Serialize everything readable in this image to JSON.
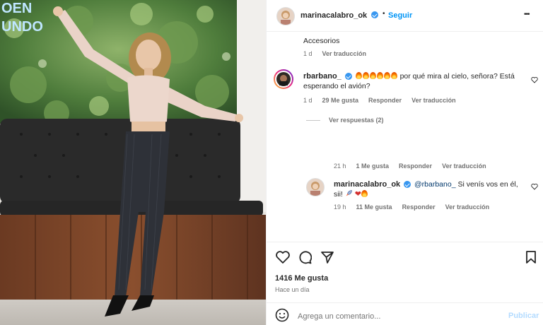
{
  "post": {
    "author": "marinacalabro_ok",
    "follow": "Seguir",
    "more": "•••",
    "photo_text": "OEN UNDO"
  },
  "caption_tail": {
    "text": "Accesorios",
    "time": "1 d",
    "translate": "Ver traducción"
  },
  "comment1": {
    "user": "rbarbano_",
    "text_line1": "por qué mira al cielo, señora? Está",
    "text_line2": "esperando el avión?",
    "time": "1 d",
    "likes": "29 Me gusta",
    "reply": "Responder",
    "translate": "Ver traducción",
    "view_replies": "Ver respuestas (2)"
  },
  "reply1_meta": {
    "time": "21 h",
    "likes": "1 Me gusta",
    "reply": "Responder",
    "translate": "Ver traducción"
  },
  "reply2": {
    "user": "marinacalabro_ok",
    "mention": "@rbarbano_",
    "text_line1": "Si venís vos en él,",
    "text_line2": "sii!",
    "time": "19 h",
    "likes": "11 Me gusta",
    "reply": "Responder",
    "translate": "Ver traducción"
  },
  "actions": {
    "likes": "1416 Me gusta",
    "when": "Hace un día"
  },
  "composer": {
    "placeholder": "Agrega un comentario...",
    "publish": "Publicar"
  },
  "icons": [
    "heart-icon",
    "comment-icon",
    "share-icon",
    "bookmark-icon",
    "emoji-icon",
    "more-icon",
    "verified-icon",
    "fire-icon",
    "rocket-icon"
  ],
  "colors": {
    "accent": "#0095f6",
    "verified": "#3897f0",
    "muted": "#737373"
  }
}
